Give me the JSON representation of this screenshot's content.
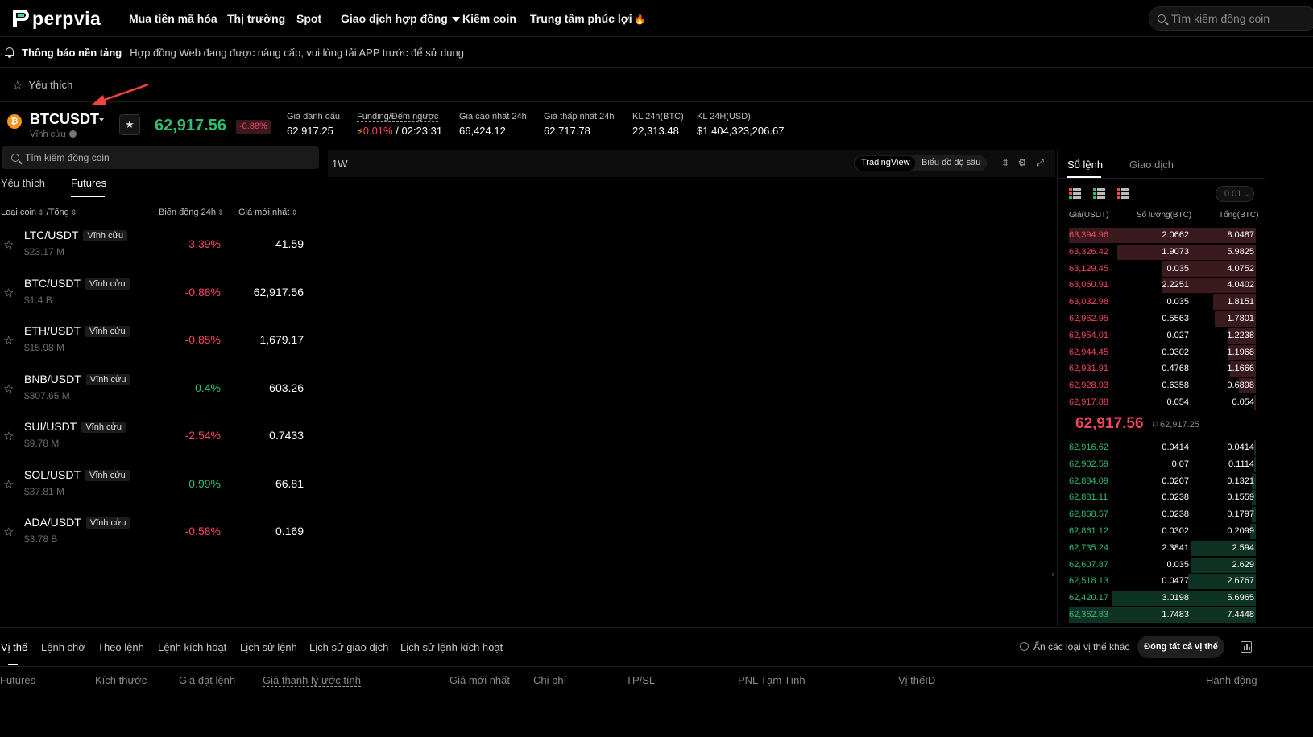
{
  "nav": {
    "brand": "perpvia",
    "items": [
      "Mua tiền mã hóa",
      "Thị trường",
      "Spot",
      "Giao dịch hợp đồng",
      "Kiếm coin",
      "Trung tâm phúc lợi"
    ],
    "search_placeholder": "Tìm kiếm đồng coin"
  },
  "notice": {
    "title": "Thông báo nền tảng",
    "text": "Hợp đồng Web đang được nâng cấp, vui lòng tải APP trước để sử dụng"
  },
  "favbar": {
    "label": "Yêu thích"
  },
  "ticker": {
    "coin_glyph": "₿",
    "symbol": "BTCUSDT",
    "subtitle": "Vĩnh cửu",
    "last_price": "62,917.56",
    "change": "-0.88%",
    "stats": {
      "mark_label": "Giá đánh dấu",
      "mark_value": "62,917.25",
      "funding_label": "Funding/Đếm ngược",
      "funding_rate": "0.01%",
      "funding_sep": "/",
      "countdown": "02:23:31",
      "high_label": "Giá cao nhất 24h",
      "high_value": "66,424.12",
      "low_label": "Giá thấp nhất 24h",
      "low_value": "62,717.78",
      "vol_btc_label": "KL 24h(BTC)",
      "vol_btc_value": "22,313.48",
      "vol_usd_label": "KL 24H(USD)",
      "vol_usd_value": "$1,404,323,206.67"
    }
  },
  "market": {
    "search_placeholder": "Tìm kiếm đồng coin",
    "tabs": [
      "Yêu thích",
      "Futures"
    ],
    "headers": {
      "coin": "Loại coin",
      "total": "/Tổng",
      "change": "Biến động 24h",
      "last": "Giá mới nhất"
    },
    "rows": [
      {
        "pair": "LTC/USDT",
        "tag": "Vĩnh cửu",
        "vol": "$23.17 M",
        "change": "-3.39%",
        "last": "41.59",
        "up": false
      },
      {
        "pair": "BTC/USDT",
        "tag": "Vĩnh cửu",
        "vol": "$1.4 B",
        "change": "-0.88%",
        "last": "62,917.56",
        "up": false
      },
      {
        "pair": "ETH/USDT",
        "tag": "Vĩnh cửu",
        "vol": "$15.98 M",
        "change": "-0.85%",
        "last": "1,679.17",
        "up": false
      },
      {
        "pair": "BNB/USDT",
        "tag": "Vĩnh cửu",
        "vol": "$307.65 M",
        "change": "0.4%",
        "last": "603.26",
        "up": true
      },
      {
        "pair": "SUI/USDT",
        "tag": "Vĩnh cửu",
        "vol": "$9.78 M",
        "change": "-2.54%",
        "last": "0.7433",
        "up": false
      },
      {
        "pair": "SOL/USDT",
        "tag": "Vĩnh cửu",
        "vol": "$37.81 M",
        "change": "0.99%",
        "last": "66.81",
        "up": true
      },
      {
        "pair": "ADA/USDT",
        "tag": "Vĩnh cửu",
        "vol": "$3.78 B",
        "change": "-0.58%",
        "last": "0.169",
        "up": false
      }
    ]
  },
  "chart": {
    "timeframe": "1W",
    "views": [
      "TradingView",
      "Biểu đồ độ sâu"
    ]
  },
  "orderbook": {
    "tabs": [
      "Sổ lệnh",
      "Giao dịch"
    ],
    "precision": "0.01",
    "headers": {
      "price": "Giá(USDT)",
      "qty": "Số lượng(BTC)",
      "total": "Tổng(BTC)"
    },
    "asks": [
      {
        "price": "63,394.96",
        "qty": "2.0662",
        "total": "8.0487",
        "depth": 1.0
      },
      {
        "price": "63,326.42",
        "qty": "1.9073",
        "total": "5.9825",
        "depth": 0.74
      },
      {
        "price": "63,129.45",
        "qty": "0.035",
        "total": "4.0752",
        "depth": 0.5
      },
      {
        "price": "63,060.91",
        "qty": "2.2251",
        "total": "4.0402",
        "depth": 0.5
      },
      {
        "price": "63,032.98",
        "qty": "0.035",
        "total": "1.8151",
        "depth": 0.23
      },
      {
        "price": "62,962.95",
        "qty": "0.5563",
        "total": "1.7801",
        "depth": 0.22
      },
      {
        "price": "62,954.01",
        "qty": "0.027",
        "total": "1.2238",
        "depth": 0.15
      },
      {
        "price": "62,944.45",
        "qty": "0.0302",
        "total": "1.1968",
        "depth": 0.15
      },
      {
        "price": "62,931.91",
        "qty": "0.4768",
        "total": "1.1666",
        "depth": 0.14
      },
      {
        "price": "62,928.93",
        "qty": "0.6358",
        "total": "0.6898",
        "depth": 0.09
      },
      {
        "price": "62,917.88",
        "qty": "0.054",
        "total": "0.054",
        "depth": 0.01
      }
    ],
    "mid_price": "62,917.56",
    "mark_price": "62,917.25",
    "bids": [
      {
        "price": "62,916.62",
        "qty": "0.0414",
        "total": "0.0414",
        "depth": 0.01
      },
      {
        "price": "62,902.59",
        "qty": "0.07",
        "total": "0.1114",
        "depth": 0.01
      },
      {
        "price": "62,884.09",
        "qty": "0.0207",
        "total": "0.1321",
        "depth": 0.02
      },
      {
        "price": "62,881.11",
        "qty": "0.0238",
        "total": "0.1559",
        "depth": 0.02
      },
      {
        "price": "62,868.57",
        "qty": "0.0238",
        "total": "0.1797",
        "depth": 0.02
      },
      {
        "price": "62,861.12",
        "qty": "0.0302",
        "total": "0.2099",
        "depth": 0.03
      },
      {
        "price": "62,735.24",
        "qty": "2.3841",
        "total": "2.594",
        "depth": 0.35
      },
      {
        "price": "62,607.87",
        "qty": "0.035",
        "total": "2.629",
        "depth": 0.35
      },
      {
        "price": "62,518.13",
        "qty": "0.0477",
        "total": "2.6767",
        "depth": 0.36
      },
      {
        "price": "62,420.17",
        "qty": "3.0198",
        "total": "5.6965",
        "depth": 0.77
      },
      {
        "price": "62,362.83",
        "qty": "1.7483",
        "total": "7.4448",
        "depth": 1.0
      }
    ]
  },
  "positions": {
    "tabs": [
      "Vị thế",
      "Lệnh chờ",
      "Theo lệnh",
      "Lệnh kích hoạt",
      "Lịch sử lệnh",
      "Lịch sử giao dịch",
      "Lịch sử lệnh kích hoạt"
    ],
    "hide_other": "Ẩn các loại vị thế khác",
    "close_all": "Đóng tất cả vị thế",
    "columns": [
      "Futures",
      "Kích thước",
      "Giá đặt lệnh",
      "Giá thanh lý ước tính",
      "Giá mới nhất",
      "Chi phí",
      "TP/SL",
      "PNL Tạm Tính",
      "Vị thếID",
      "Hành động"
    ]
  },
  "colors": {
    "up": "#2fbf71",
    "down": "#f6465d",
    "accent_brand": "#2ee59d",
    "ask_depth": "#3a1a1f",
    "bid_depth": "#0e3324"
  }
}
